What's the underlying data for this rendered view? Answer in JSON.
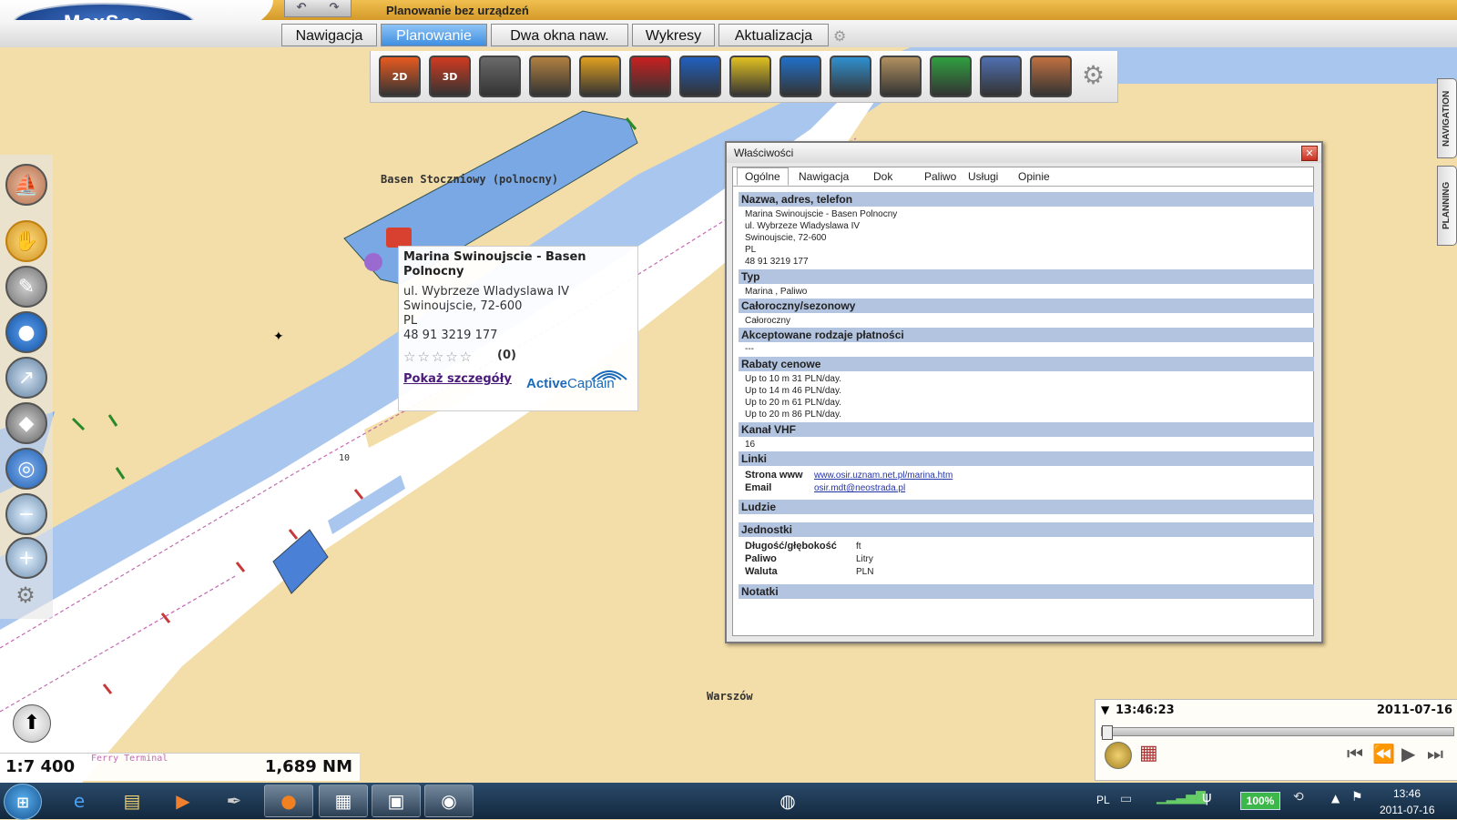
{
  "app": {
    "logo": "MaxSea",
    "mode_title": "Planowanie bez urządzeń",
    "undo_icons": [
      "↶",
      "↷"
    ]
  },
  "tabs": [
    {
      "label": "Nawigacja",
      "active": false
    },
    {
      "label": "Planowanie",
      "active": true
    },
    {
      "label": "Dwa okna naw.",
      "active": false
    },
    {
      "label": "Wykresy",
      "active": false
    },
    {
      "label": "Aktualizacja",
      "active": false
    }
  ],
  "toolbar": {
    "tools": [
      {
        "icon": "chart-2d-icon",
        "label": "2D",
        "color": "#e85a20"
      },
      {
        "icon": "chart-3d-icon",
        "label": "3D",
        "color": "#d03a20"
      },
      {
        "icon": "photo-overlay-icon",
        "label": "",
        "color": "#6a6a6a"
      },
      {
        "icon": "satellite-photo-icon",
        "label": "",
        "color": "#b08040"
      },
      {
        "icon": "sea-temperature-icon",
        "label": "",
        "color": "#e0a020"
      },
      {
        "icon": "boat-icon",
        "label": "",
        "color": "#c82020"
      },
      {
        "icon": "tides-icon",
        "label": "",
        "color": "#2060c0"
      },
      {
        "icon": "currents-icon",
        "label": "",
        "color": "#e0c020"
      },
      {
        "icon": "wind-arrows-icon",
        "label": "",
        "color": "#2070c8"
      },
      {
        "icon": "download-weather-icon",
        "label": "",
        "color": "#3090d0"
      },
      {
        "icon": "weather-cloud-icon",
        "label": "",
        "color": "#b09060"
      },
      {
        "icon": "wind-barbs-icon",
        "label": "",
        "color": "#30a040"
      },
      {
        "icon": "table-icon",
        "label": "",
        "color": "#5070b0"
      },
      {
        "icon": "radar-icon",
        "label": "",
        "color": "#c07040"
      }
    ],
    "gear_icon": "⚙"
  },
  "side_tabs": [
    "NAVIGATION",
    "PLANNING"
  ],
  "map": {
    "labels": [
      "Basen Stoczniowy (polnocny)",
      "Warszów",
      "Ferry Terminal",
      "10"
    ]
  },
  "popup": {
    "name": "Marina Swinoujscie - Basen Polnocny",
    "street": "ul. Wybrzeze Wladyslawa IV",
    "city": "Swinoujscie, 72-600",
    "country": "PL",
    "phone": "48 91 3219 177",
    "stars": "☆☆☆☆☆",
    "rating_count": "(0)",
    "details_link": "Pokaż szczegóły",
    "brand_bold": "Active",
    "brand_light": "Captain"
  },
  "dialog": {
    "title": "Właściwości",
    "close": "✕",
    "tabs": [
      "Ogólne",
      "Nawigacja",
      "Dok",
      "Paliwo",
      "Usługi",
      "Opinie"
    ],
    "sections": {
      "name_address": "Nazwa, adres, telefon",
      "type": "Typ",
      "seasonal": "Całoroczny/sezonowy",
      "payments": "Akceptowane rodzaje płatności",
      "rates": "Rabaty cenowe",
      "vhf": "Kanał VHF",
      "links": "Linki",
      "people": "Ludzie",
      "units": "Jednostki",
      "notes": "Notatki"
    },
    "address_lines": [
      "Marina Swinoujscie - Basen Polnocny",
      "ul. Wybrzeze Wladyslawa IV",
      "Swinoujscie, 72-600",
      "PL",
      " 48 91 3219 177"
    ],
    "type_value": "Marina , Paliwo",
    "seasonal_value": "Całoroczny",
    "payments_value": "---",
    "rates": [
      "Up to 10 m 31 PLN/day.",
      "Up to 14 m 46 PLN/day.",
      "Up to 20 m 61 PLN/day.",
      "Up to 20 m 86 PLN/day."
    ],
    "vhf_value": "16",
    "links": {
      "www_label": "Strona www",
      "www": "www.osir.uznam.net.pl/marina.htm",
      "email_label": "Email",
      "email": "osir.mdt@neostrada.pl"
    },
    "units": {
      "length_label": "Długość/głębokość",
      "length": "ft",
      "fuel_label": "Paliwo",
      "fuel": "Litry",
      "currency_label": "Waluta",
      "currency": "PLN"
    }
  },
  "status": {
    "scale": "1:7 400",
    "distance": "1,689 NM"
  },
  "time_panel": {
    "time": "13:46:23",
    "date": "2011-07-16",
    "controls": [
      "⏮",
      "⏪",
      "▶",
      "⏭"
    ]
  },
  "taskbar": {
    "lang": "PL",
    "battery": "100%",
    "clock_time": "13:46",
    "clock_date": "2011-07-16"
  },
  "colors": {
    "land": "#f3dda8",
    "water_deep": "#ffffff",
    "water_shallow": "#a9c6ee",
    "water_mid": "#7aa8e4",
    "header_gold": "#e0b040",
    "tab_active": "#3f8fe0",
    "section_header": "#b3c4e0"
  }
}
